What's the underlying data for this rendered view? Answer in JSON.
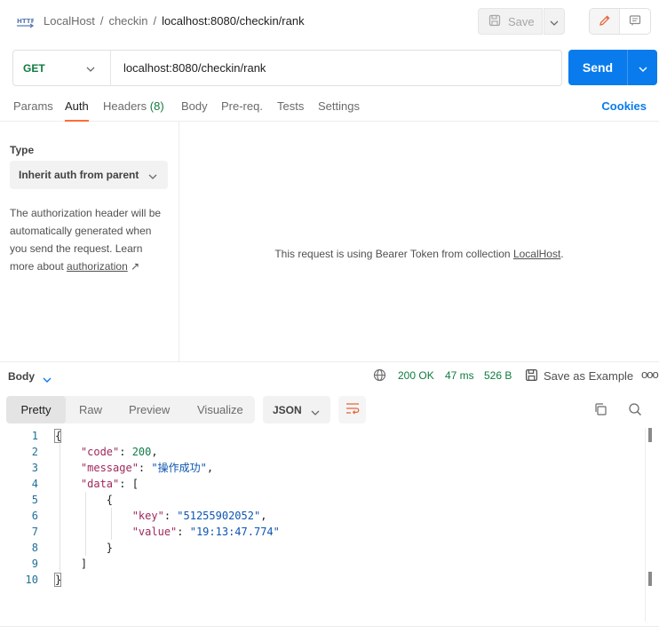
{
  "topbar": {
    "icon": "http-request-icon",
    "breadcrumb": [
      "LocalHost",
      "checkin"
    ],
    "current": "localhost:8080/checkin/rank",
    "save_label": "Save"
  },
  "request": {
    "method": "GET",
    "url": "localhost:8080/checkin/rank",
    "send_label": "Send"
  },
  "req_tabs": {
    "params": "Params",
    "auth": "Auth",
    "headers": "Headers",
    "headers_count": "(8)",
    "body": "Body",
    "prereq": "Pre-req.",
    "tests": "Tests",
    "settings": "Settings",
    "active": "Auth",
    "cookies": "Cookies"
  },
  "auth": {
    "type_label": "Type",
    "type_value": "Inherit auth from parent",
    "description": "The authorization header will be automatically generated when you send the request. Learn more about",
    "link": "authorization",
    "link_arrow": "↗",
    "message_prefix": "This request is using Bearer Token from collection",
    "message_collection": "LocalHost",
    "message_suffix": "."
  },
  "response": {
    "body_label": "Body",
    "status": "200 OK",
    "time": "47 ms",
    "size": "526 B",
    "save_example": "Save as Example",
    "more": "ooo",
    "view_tabs": [
      "Pretty",
      "Raw",
      "Preview",
      "Visualize"
    ],
    "active_view": "Pretty",
    "format": "JSON"
  },
  "code_lines": [
    {
      "n": "1",
      "parts": [
        [
          "punc",
          "{"
        ]
      ]
    },
    {
      "n": "2",
      "parts": [
        [
          "key",
          "    \"code\""
        ],
        [
          "punc",
          ": "
        ],
        [
          "num",
          "200"
        ],
        [
          "punc",
          ","
        ]
      ]
    },
    {
      "n": "3",
      "parts": [
        [
          "key",
          "    \"message\""
        ],
        [
          "punc",
          ": "
        ],
        [
          "str",
          "\"操作成功\""
        ],
        [
          "punc",
          ","
        ]
      ]
    },
    {
      "n": "4",
      "parts": [
        [
          "key",
          "    \"data\""
        ],
        [
          "punc",
          ": ["
        ]
      ]
    },
    {
      "n": "5",
      "parts": [
        [
          "punc",
          "        {"
        ]
      ]
    },
    {
      "n": "6",
      "parts": [
        [
          "key",
          "            \"key\""
        ],
        [
          "punc",
          ": "
        ],
        [
          "str",
          "\"51255902052\""
        ],
        [
          "punc",
          ","
        ]
      ]
    },
    {
      "n": "7",
      "parts": [
        [
          "key",
          "            \"value\""
        ],
        [
          "punc",
          ": "
        ],
        [
          "str",
          "\"19:13:47.774\""
        ]
      ]
    },
    {
      "n": "8",
      "parts": [
        [
          "punc",
          "        }"
        ]
      ]
    },
    {
      "n": "9",
      "parts": [
        [
          "punc",
          "    ]"
        ]
      ]
    },
    {
      "n": "10",
      "parts": [
        [
          "punc",
          "}"
        ]
      ]
    }
  ],
  "colors": {
    "send": "#097bed",
    "method_get": "#0f7b3f",
    "status_ok": "#0f7b3f",
    "active_tab_underline": "#ff6c37",
    "json_key": "#a0285d",
    "json_string": "#0d55b2",
    "json_number": "#117a47"
  }
}
